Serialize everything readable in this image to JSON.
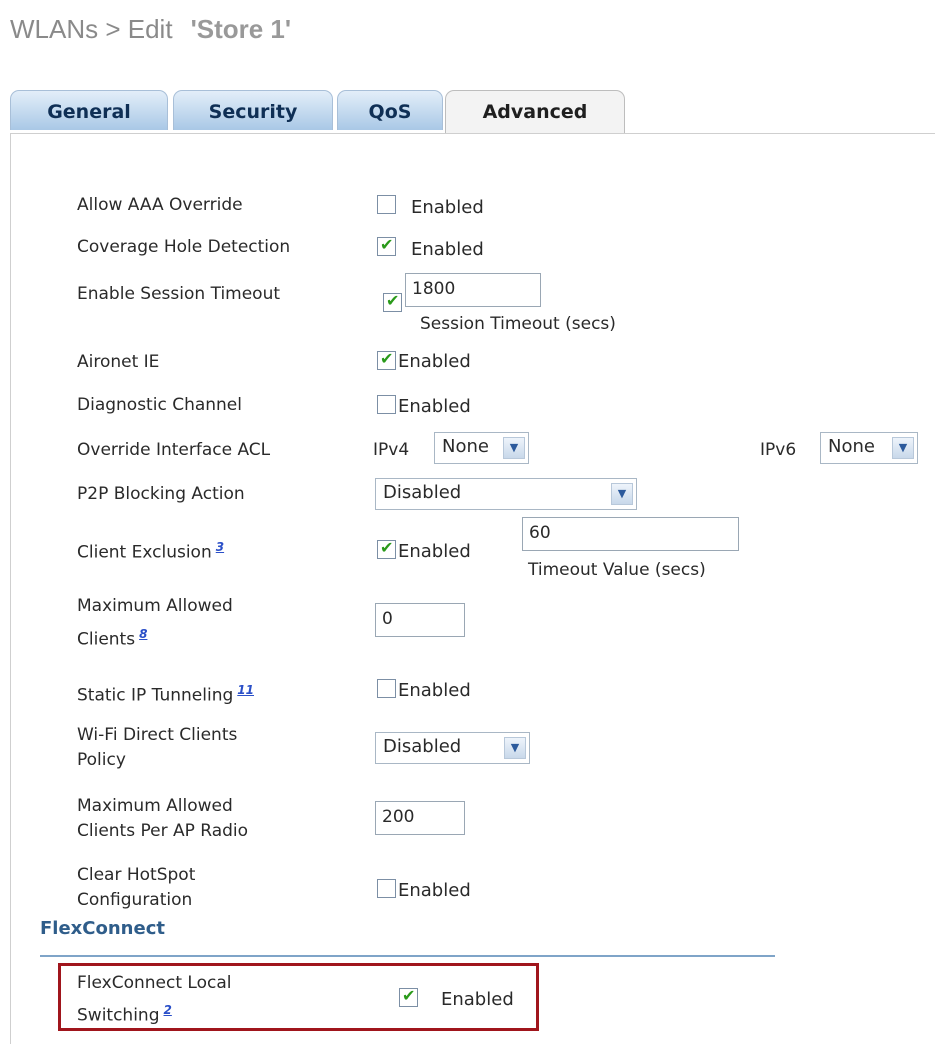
{
  "page": {
    "title_prefix": "WLANs > Edit",
    "title_name": "'Store 1'"
  },
  "tabs": [
    "General",
    "Security",
    "QoS",
    "Advanced"
  ],
  "rows": {
    "aaa_override": {
      "label": "Allow AAA Override",
      "checked": false,
      "text": "Enabled"
    },
    "coverage_hole": {
      "label": "Coverage Hole Detection",
      "checked": true,
      "text": "Enabled"
    },
    "session_timeout": {
      "label": "Enable Session Timeout",
      "checked": true,
      "value": "1800",
      "caption": "Session Timeout (secs)"
    },
    "aironet_ie": {
      "label": "Aironet IE",
      "checked": true,
      "text": "Enabled"
    },
    "diag_channel": {
      "label": "Diagnostic Channel",
      "checked": false,
      "text": "Enabled"
    },
    "override_acl": {
      "label": "Override Interface ACL",
      "ipv4_label": "IPv4",
      "ipv4_value": "None",
      "ipv6_label": "IPv6",
      "ipv6_value": "None"
    },
    "p2p_blocking": {
      "label": "P2P Blocking Action",
      "value": "Disabled"
    },
    "client_exclusion": {
      "label": "Client Exclusion",
      "footnote": "3",
      "checked": true,
      "text": "Enabled",
      "value": "60",
      "caption": "Timeout Value (secs)"
    },
    "max_clients": {
      "label_line1": "Maximum Allowed",
      "label_line2": "Clients",
      "footnote": "8",
      "value": "0"
    },
    "static_ip": {
      "label": "Static IP Tunneling",
      "footnote": "11",
      "checked": false,
      "text": "Enabled"
    },
    "wifi_direct": {
      "label_line1": "Wi-Fi Direct Clients",
      "label_line2": "Policy",
      "value": "Disabled"
    },
    "max_clients_radio": {
      "label_line1": "Maximum Allowed",
      "label_line2": "Clients Per AP Radio",
      "value": "200"
    },
    "clear_hotspot": {
      "label_line1": "Clear HotSpot",
      "label_line2": "Configuration",
      "checked": false,
      "text": "Enabled"
    }
  },
  "flexconnect": {
    "section_title": "FlexConnect",
    "local_switching": {
      "label_line1": "FlexConnect Local",
      "label_line2": "Switching",
      "footnote": "2",
      "checked": true,
      "text": "Enabled"
    }
  },
  "colors": {
    "checkmark": "#2a9a1a",
    "tab_active": "#f3f3f3",
    "tab_inactive": "#a9c8e6",
    "section": "#2f5d8a",
    "highlight_border": "#a0151c"
  }
}
